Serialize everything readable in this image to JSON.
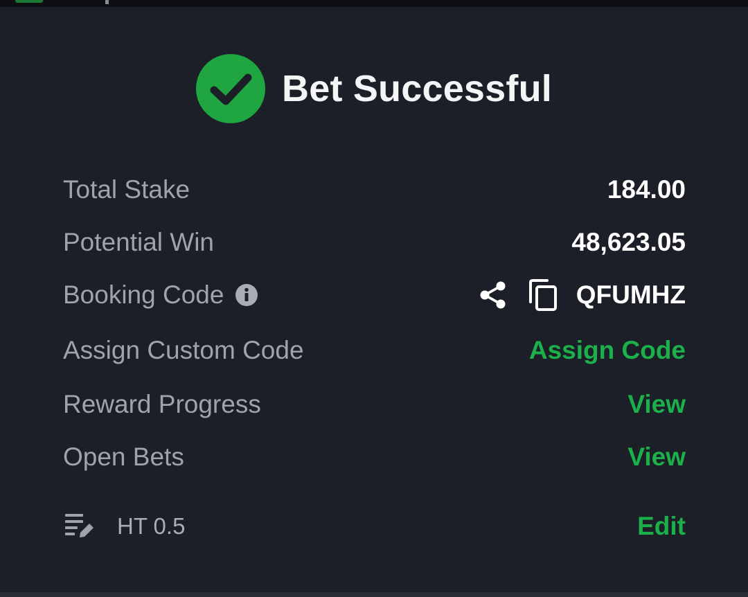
{
  "header": {
    "title": "Bet Successful",
    "icon": "check-circle-icon"
  },
  "summary": {
    "total_stake_label": "Total Stake",
    "total_stake_value": "184.00",
    "potential_win_label": "Potential Win",
    "potential_win_value": "48,623.05",
    "booking_code_label": "Booking Code",
    "booking_code_value": "QFUMHZ",
    "assign_custom_code_label": "Assign Custom Code",
    "assign_code_link": "Assign Code",
    "reward_progress_label": "Reward Progress",
    "reward_progress_link": "View",
    "open_bets_label": "Open Bets",
    "open_bets_link": "View"
  },
  "note": {
    "text": "HT 0.5",
    "edit_link": "Edit"
  },
  "colors": {
    "background": "#1c1f27",
    "accent_green": "#1bb04a",
    "label_gray": "#9fa3ab",
    "value_white": "#ffffff"
  }
}
